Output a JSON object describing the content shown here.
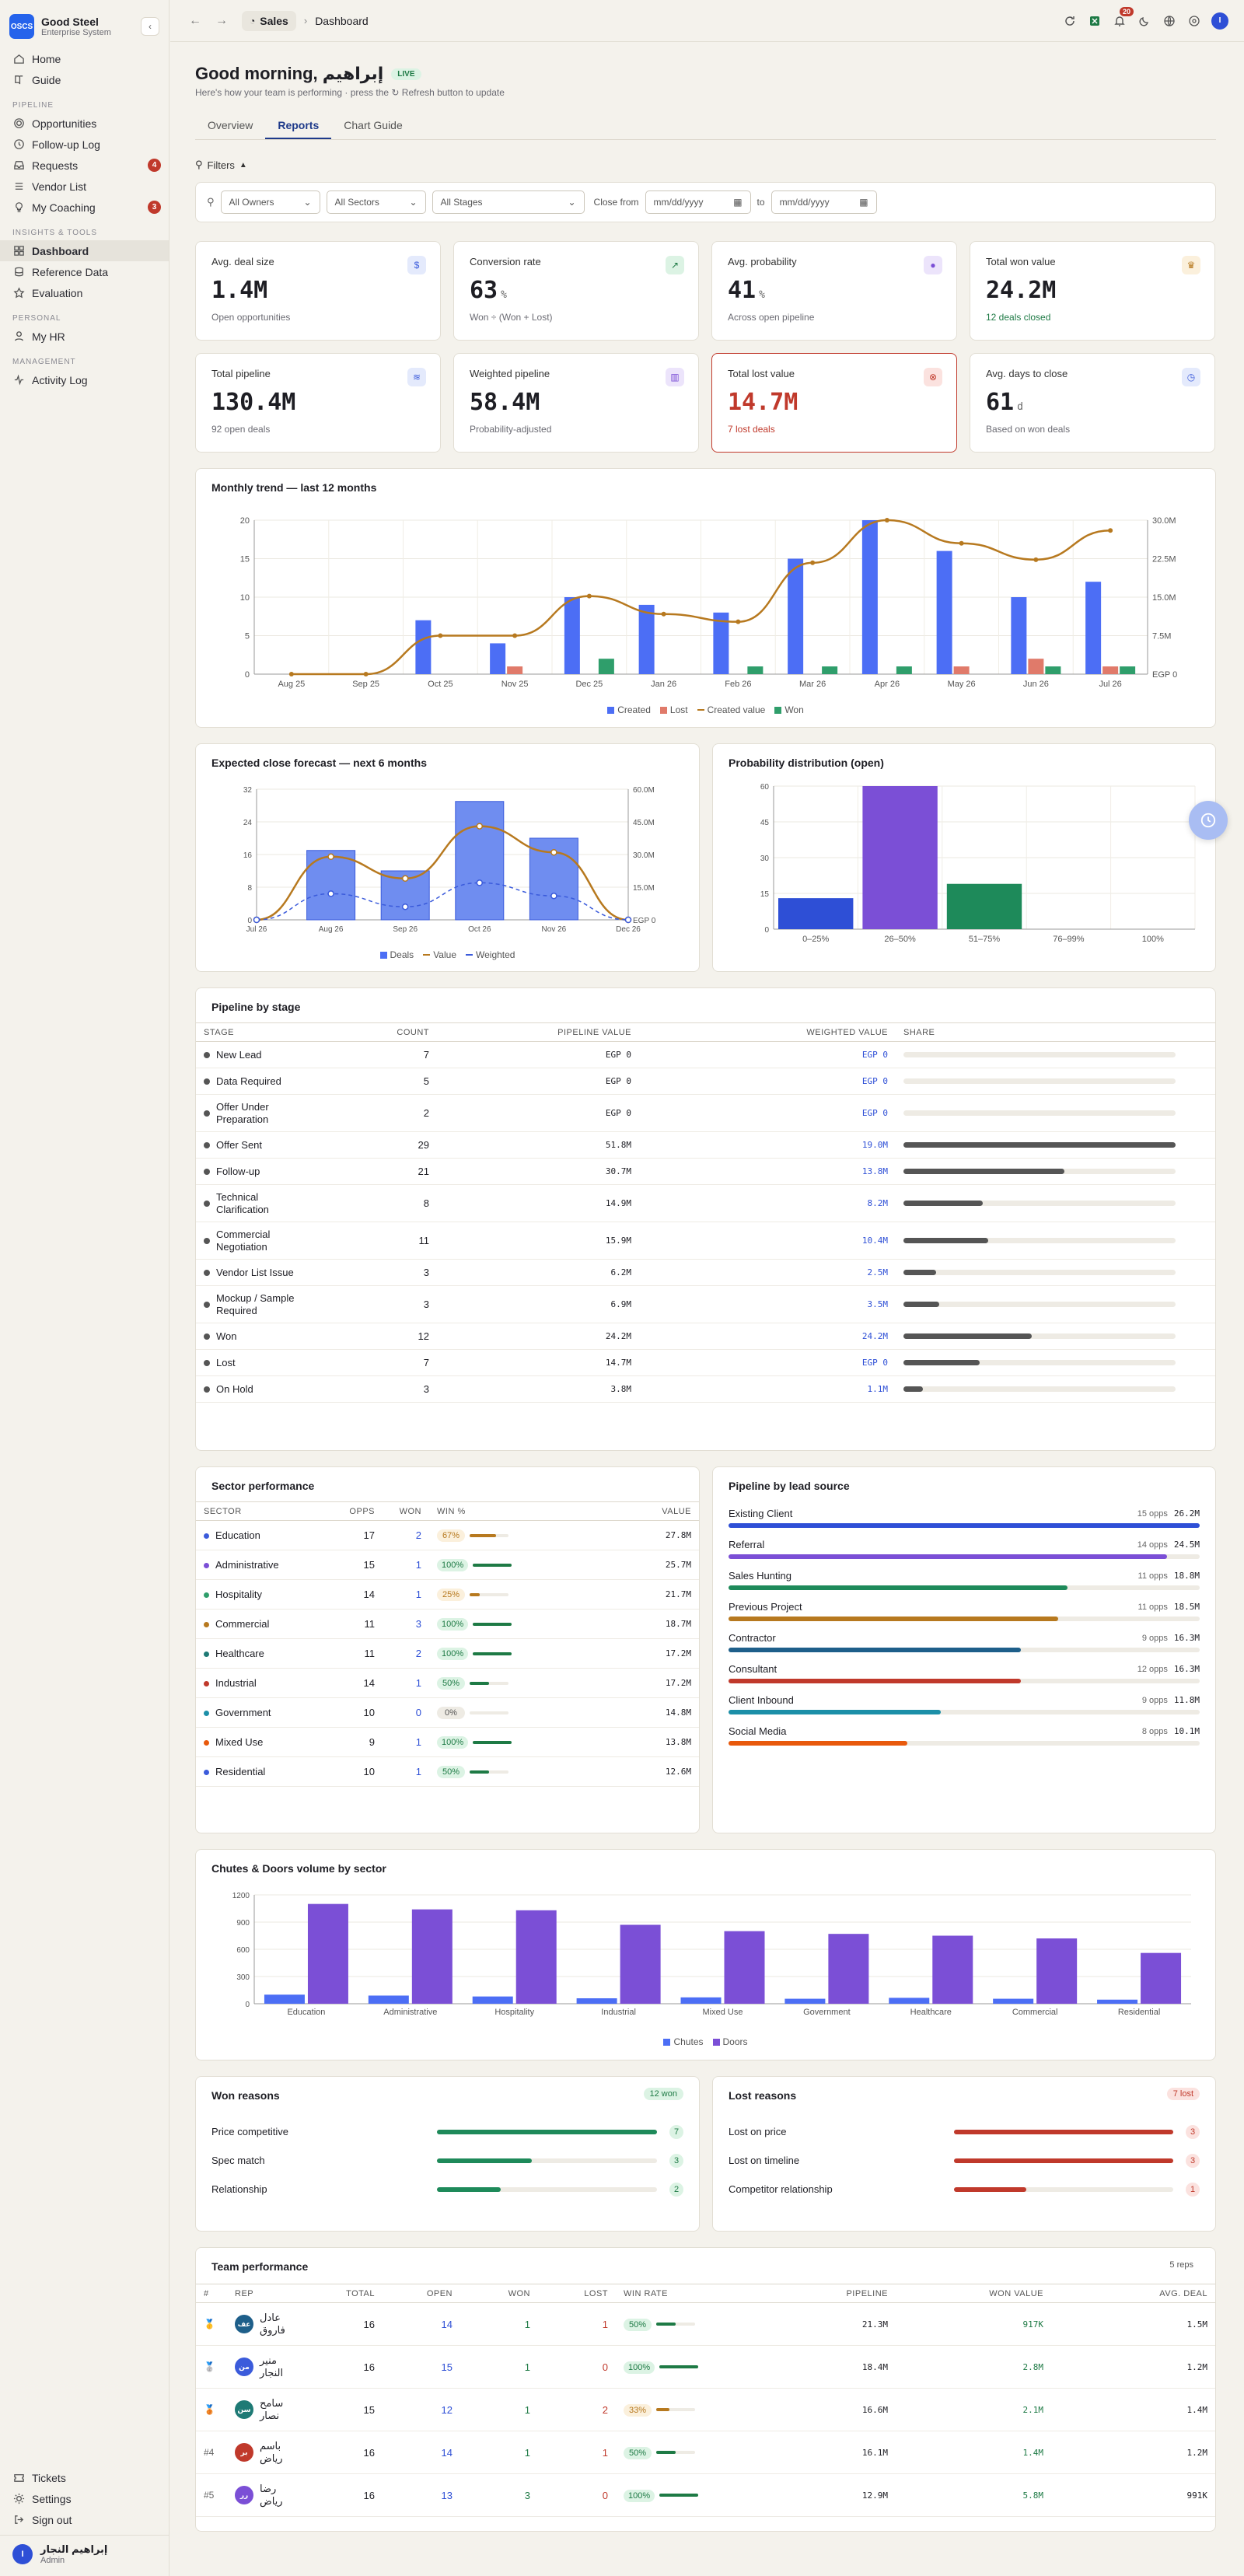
{
  "brand": {
    "logo": "OSCS",
    "name": "Good Steel",
    "sub": "Enterprise System"
  },
  "nav": {
    "top": [
      {
        "label": "Home",
        "icon": "home-icon"
      },
      {
        "label": "Guide",
        "icon": "book-icon"
      }
    ],
    "pipeline_title": "PIPELINE",
    "pipeline": [
      {
        "label": "Opportunities",
        "icon": "target-icon",
        "badge": ""
      },
      {
        "label": "Follow-up Log",
        "icon": "clock-icon",
        "badge": ""
      },
      {
        "label": "Requests",
        "icon": "inbox-icon",
        "badge": "4"
      },
      {
        "label": "Vendor List",
        "icon": "list-icon",
        "badge": ""
      },
      {
        "label": "My Coaching",
        "icon": "lightbulb-icon",
        "badge": "3"
      }
    ],
    "insights_title": "INSIGHTS & TOOLS",
    "insights": [
      {
        "label": "Dashboard",
        "icon": "grid-icon",
        "active": true
      },
      {
        "label": "Reference Data",
        "icon": "database-icon"
      },
      {
        "label": "Evaluation",
        "icon": "star-icon"
      }
    ],
    "personal_title": "PERSONAL",
    "personal": [
      {
        "label": "My HR",
        "icon": "person-icon"
      }
    ],
    "management_title": "MANAGEMENT",
    "management": [
      {
        "label": "Activity Log",
        "icon": "activity-icon"
      }
    ],
    "bottom": [
      {
        "label": "Tickets",
        "icon": "ticket-icon"
      },
      {
        "label": "Settings",
        "icon": "gear-icon"
      },
      {
        "label": "Sign out",
        "icon": "signout-icon"
      }
    ]
  },
  "user": {
    "initial": "I",
    "name": "إبراهيم النجار",
    "role": "Admin"
  },
  "topbar": {
    "crumb_root": "Sales",
    "crumb_current": "Dashboard",
    "notif_count": "20",
    "avatar": "I"
  },
  "header": {
    "greeting": "Good morning, إبراهيم",
    "live": "LIVE",
    "subtitle": "Here's how your team is performing · press the ↻ Refresh button to update"
  },
  "tabs": [
    "Overview",
    "Reports",
    "Chart Guide"
  ],
  "filters": {
    "toggle": "Filters",
    "owners": "All Owners",
    "sectors": "All Sectors",
    "stages": "All Stages",
    "close_from": "Close from",
    "date_ph": "mm/dd/yyyy",
    "to": "to"
  },
  "kpis": [
    {
      "title": "Avg. deal size",
      "value": "1.4M",
      "unit": "",
      "sub": "Open opportunities",
      "icon": "$",
      "color": "#3b5bdb",
      "bg": "#e4eafc",
      "sub_color": "#6b6b73"
    },
    {
      "title": "Conversion rate",
      "value": "63",
      "unit": "%",
      "sub": "Won ÷ (Won + Lost)",
      "icon": "↗",
      "color": "#1e7a45",
      "bg": "#dcf3e4",
      "sub_color": "#6b6b73"
    },
    {
      "title": "Avg. probability",
      "value": "41",
      "unit": "%",
      "sub": "Across open pipeline",
      "icon": "●",
      "color": "#7b4fd6",
      "bg": "#ece4fb",
      "sub_color": "#6b6b73"
    },
    {
      "title": "Total won value",
      "value": "24.2M",
      "unit": "",
      "sub": "12 deals closed",
      "icon": "♛",
      "color": "#b7791f",
      "bg": "#fbf0dc",
      "sub_color": "#1e7a45"
    },
    {
      "title": "Total pipeline",
      "value": "130.4M",
      "unit": "",
      "sub": "92 open deals",
      "icon": "≋",
      "color": "#3b5bdb",
      "bg": "#e4eafc",
      "sub_color": "#6b6b73"
    },
    {
      "title": "Weighted pipeline",
      "value": "58.4M",
      "unit": "",
      "sub": "Probability-adjusted",
      "icon": "▥",
      "color": "#7b4fd6",
      "bg": "#ece4fb",
      "sub_color": "#6b6b73"
    },
    {
      "title": "Total lost value",
      "value": "14.7M",
      "unit": "",
      "sub": "7 lost deals",
      "icon": "⊗",
      "color": "#c0392b",
      "bg": "#fbe2df",
      "sub_color": "#c0392b",
      "alert": true
    },
    {
      "title": "Avg. days to close",
      "value": "61",
      "unit": "d",
      "sub": "Based on won deals",
      "icon": "◷",
      "color": "#3b5bdb",
      "bg": "#e4eafc",
      "sub_color": "#6b6b73"
    }
  ],
  "monthly": {
    "title": "Monthly trend — last 12 months",
    "chart_data": {
      "type": "bar",
      "categories": [
        "Aug 25",
        "Sep 25",
        "Oct 25",
        "Nov 25",
        "Dec 25",
        "Jan 26",
        "Feb 26",
        "Mar 26",
        "Apr 26",
        "May 26",
        "Jun 26",
        "Jul 26"
      ],
      "series": [
        {
          "name": "Created",
          "values": [
            0,
            0,
            7,
            4,
            10,
            9,
            8,
            15,
            20,
            16,
            10,
            12
          ],
          "color": "#4c6ef5"
        },
        {
          "name": "Lost",
          "values": [
            0,
            0,
            0,
            1,
            0,
            0,
            0,
            0,
            0,
            1,
            2,
            1
          ],
          "color": "#e07a6a"
        },
        {
          "name": "Won",
          "values": [
            0,
            0,
            0,
            0,
            2,
            0,
            1,
            1,
            1,
            0,
            1,
            1
          ],
          "color": "#2f9e6b"
        },
        {
          "name": "Created value",
          "values": [
            0,
            0,
            7.5,
            7.5,
            15.2,
            11.7,
            10.2,
            21.7,
            30,
            25.5,
            22.3,
            28
          ],
          "color": "#b7791f",
          "axis": "right"
        }
      ],
      "ylim": [
        0,
        20
      ],
      "y2lim": [
        0,
        30
      ],
      "yticks": [
        0,
        5,
        10,
        15,
        20
      ],
      "y2ticks": [
        "EGP 0",
        "7.5M",
        "15.0M",
        "22.5M",
        "30.0M"
      ]
    }
  },
  "forecast": {
    "title": "Expected close forecast — next 6 months",
    "chart_data": {
      "type": "bar",
      "categories": [
        "Jul 26",
        "Aug 26",
        "Sep 26",
        "Oct 26",
        "Nov 26",
        "Dec 26"
      ],
      "series": [
        {
          "name": "Deals",
          "values": [
            0,
            17,
            12,
            29,
            20,
            0
          ],
          "color": "#4c6ef5"
        },
        {
          "name": "Value",
          "values": [
            0,
            29,
            19,
            43,
            31,
            0
          ],
          "color": "#b7791f",
          "axis": "right"
        },
        {
          "name": "Weighted",
          "values": [
            0,
            12,
            6,
            17,
            11,
            0
          ],
          "color": "#3b5bdb",
          "axis": "right"
        }
      ],
      "ylim": [
        0,
        32
      ],
      "y2lim": [
        0,
        60
      ],
      "yticks": [
        0,
        8,
        16,
        24,
        32
      ],
      "y2ticks": [
        "EGP 0",
        "15.0M",
        "30.0M",
        "45.0M",
        "60.0M"
      ]
    }
  },
  "probability": {
    "title": "Probability distribution (open)",
    "chart_data": {
      "type": "bar",
      "categories": [
        "0–25%",
        "26–50%",
        "51–75%",
        "76–99%",
        "100%"
      ],
      "values": [
        13,
        60,
        19,
        0,
        0
      ],
      "colors": [
        "#2e4fd6",
        "#7b4fd6",
        "#1e8a5a",
        "#999",
        "#999"
      ],
      "ylim": [
        0,
        60
      ],
      "yticks": [
        0,
        15,
        30,
        45,
        60
      ]
    }
  },
  "stages": {
    "title": "Pipeline by stage",
    "cols": [
      "STAGE",
      "COUNT",
      "PIPELINE VALUE",
      "WEIGHTED VALUE",
      "SHARE"
    ],
    "rows": [
      {
        "stage": "New Lead",
        "count": "7",
        "pv": "EGP 0",
        "wv": "EGP 0",
        "share": 0,
        "h": 34
      },
      {
        "stage": "Data Required",
        "count": "5",
        "pv": "EGP 0",
        "wv": "EGP 0",
        "share": 0,
        "h": 34
      },
      {
        "stage": "Offer Under Preparation",
        "count": "2",
        "pv": "EGP 0",
        "wv": "EGP 0",
        "share": 0,
        "h": 48
      },
      {
        "stage": "Offer Sent",
        "count": "29",
        "pv": "51.8M",
        "wv": "19.0M",
        "share": 1,
        "h": 34
      },
      {
        "stage": "Follow-up",
        "count": "21",
        "pv": "30.7M",
        "wv": "13.8M",
        "share": 0.59,
        "h": 34
      },
      {
        "stage": "Technical Clarification",
        "count": "8",
        "pv": "14.9M",
        "wv": "8.2M",
        "share": 0.29,
        "h": 48
      },
      {
        "stage": "Commercial Negotiation",
        "count": "11",
        "pv": "15.9M",
        "wv": "10.4M",
        "share": 0.31,
        "h": 48
      },
      {
        "stage": "Vendor List Issue",
        "count": "3",
        "pv": "6.2M",
        "wv": "2.5M",
        "share": 0.12,
        "h": 34
      },
      {
        "stage": "Mockup / Sample Required",
        "count": "3",
        "pv": "6.9M",
        "wv": "3.5M",
        "share": 0.13,
        "h": 48
      },
      {
        "stage": "Won",
        "count": "12",
        "pv": "24.2M",
        "wv": "24.2M",
        "share": 0.47,
        "h": 34
      },
      {
        "stage": "Lost",
        "count": "7",
        "pv": "14.7M",
        "wv": "EGP 0",
        "share": 0.28,
        "h": 34
      },
      {
        "stage": "On Hold",
        "count": "3",
        "pv": "3.8M",
        "wv": "1.1M",
        "share": 0.07,
        "h": 34
      }
    ]
  },
  "sectors": {
    "title": "Sector performance",
    "cols": [
      "SECTOR",
      "OPPS",
      "WON",
      "WIN %",
      "VALUE"
    ],
    "rows": [
      {
        "name": "Education",
        "opps": "17",
        "won": "2",
        "win": "67%",
        "wp": 0.67,
        "value": "27.8M",
        "c": "#3b5bdb",
        "pc": "amber"
      },
      {
        "name": "Administrative",
        "opps": "15",
        "won": "1",
        "win": "100%",
        "wp": 1,
        "value": "25.7M",
        "c": "#7b4fd6",
        "pc": "green"
      },
      {
        "name": "Hospitality",
        "opps": "14",
        "won": "1",
        "win": "25%",
        "wp": 0.25,
        "value": "21.7M",
        "c": "#2f9e6b",
        "pc": "amber"
      },
      {
        "name": "Commercial",
        "opps": "11",
        "won": "3",
        "win": "100%",
        "wp": 1,
        "value": "18.7M",
        "c": "#b7791f",
        "pc": "green"
      },
      {
        "name": "Healthcare",
        "opps": "11",
        "won": "2",
        "win": "100%",
        "wp": 1,
        "value": "17.2M",
        "c": "#1e7a75",
        "pc": "green"
      },
      {
        "name": "Industrial",
        "opps": "14",
        "won": "1",
        "win": "50%",
        "wp": 0.5,
        "value": "17.2M",
        "c": "#c0392b",
        "pc": "green"
      },
      {
        "name": "Government",
        "opps": "10",
        "won": "0",
        "win": "0%",
        "wp": 0,
        "value": "14.8M",
        "c": "#1c8fa8",
        "pc": "grey"
      },
      {
        "name": "Mixed Use",
        "opps": "9",
        "won": "1",
        "win": "100%",
        "wp": 1,
        "value": "13.8M",
        "c": "#e8590c",
        "pc": "green"
      },
      {
        "name": "Residential",
        "opps": "10",
        "won": "1",
        "win": "50%",
        "wp": 0.5,
        "value": "12.6M",
        "c": "#3b5bdb",
        "pc": "green"
      }
    ]
  },
  "sources": {
    "title": "Pipeline by lead source",
    "rows": [
      {
        "name": "Existing Client",
        "opps": "15 opps",
        "value": "26.2M",
        "p": 1,
        "c": "#2e4fd6"
      },
      {
        "name": "Referral",
        "opps": "14 opps",
        "value": "24.5M",
        "p": 0.93,
        "c": "#7b4fd6"
      },
      {
        "name": "Sales Hunting",
        "opps": "11 opps",
        "value": "18.8M",
        "p": 0.72,
        "c": "#1e8a5a"
      },
      {
        "name": "Previous Project",
        "opps": "11 opps",
        "value": "18.5M",
        "p": 0.7,
        "c": "#b7791f"
      },
      {
        "name": "Contractor",
        "opps": "9 opps",
        "value": "16.3M",
        "p": 0.62,
        "c": "#1e5f8a"
      },
      {
        "name": "Consultant",
        "opps": "12 opps",
        "value": "16.3M",
        "p": 0.62,
        "c": "#c0392b"
      },
      {
        "name": "Client Inbound",
        "opps": "9 opps",
        "value": "11.8M",
        "p": 0.45,
        "c": "#1c8fa8"
      },
      {
        "name": "Social Media",
        "opps": "8 opps",
        "value": "10.1M",
        "p": 0.38,
        "c": "#e8590c"
      }
    ]
  },
  "volume": {
    "title": "Chutes & Doors volume by sector",
    "chart_data": {
      "type": "bar",
      "categories": [
        "Education",
        "Administrative",
        "Hospitality",
        "Industrial",
        "Mixed Use",
        "Government",
        "Healthcare",
        "Commercial",
        "Residential"
      ],
      "series": [
        {
          "name": "Chutes",
          "values": [
            100,
            90,
            80,
            60,
            70,
            55,
            65,
            55,
            45
          ],
          "color": "#4c6ef5"
        },
        {
          "name": "Doors",
          "values": [
            1100,
            1040,
            1030,
            870,
            800,
            770,
            750,
            720,
            560
          ],
          "color": "#7b4fd6"
        }
      ],
      "ylim": [
        0,
        1200
      ],
      "yticks": [
        0,
        300,
        600,
        900,
        1200
      ]
    }
  },
  "won_reasons": {
    "title": "Won reasons",
    "badge": "12 won",
    "rows": [
      {
        "name": "Price competitive",
        "count": "7",
        "p": 1
      },
      {
        "name": "Spec match",
        "count": "3",
        "p": 0.43
      },
      {
        "name": "Relationship",
        "count": "2",
        "p": 0.29
      }
    ]
  },
  "lost_reasons": {
    "title": "Lost reasons",
    "badge": "7 lost",
    "rows": [
      {
        "name": "Lost on price",
        "count": "3",
        "p": 1
      },
      {
        "name": "Lost on timeline",
        "count": "3",
        "p": 1
      },
      {
        "name": "Competitor relationship",
        "count": "1",
        "p": 0.33
      }
    ]
  },
  "team": {
    "title": "Team performance",
    "badge": "5 reps",
    "cols": [
      "#",
      "REP",
      "TOTAL",
      "OPEN",
      "WON",
      "LOST",
      "WIN RATE",
      "PIPELINE",
      "WON VALUE",
      "AVG. DEAL"
    ],
    "rows": [
      {
        "rank": "🥇",
        "init": "عف",
        "name": "عادل فاروق",
        "c": "#1e5f8a",
        "total": "16",
        "open": "14",
        "won": "1",
        "lost": "1",
        "win": "50%",
        "wp": 0.5,
        "pipe": "21.3M",
        "wonv": "917K",
        "avg": "1.5M",
        "pc": "green"
      },
      {
        "rank": "🥈",
        "init": "من",
        "name": "منير النجار",
        "c": "#3b5bdb",
        "total": "16",
        "open": "15",
        "won": "1",
        "lost": "0",
        "win": "100%",
        "wp": 1,
        "pipe": "18.4M",
        "wonv": "2.8M",
        "avg": "1.2M",
        "pc": "green"
      },
      {
        "rank": "🥉",
        "init": "سن",
        "name": "سامح نصار",
        "c": "#1e7a75",
        "total": "15",
        "open": "12",
        "won": "1",
        "lost": "2",
        "win": "33%",
        "wp": 0.33,
        "pipe": "16.6M",
        "wonv": "2.1M",
        "avg": "1.4M",
        "pc": "amber"
      },
      {
        "rank": "#4",
        "init": "بر",
        "name": "باسم رياض",
        "c": "#c0392b",
        "total": "16",
        "open": "14",
        "won": "1",
        "lost": "1",
        "win": "50%",
        "wp": 0.5,
        "pipe": "16.1M",
        "wonv": "1.4M",
        "avg": "1.2M",
        "pc": "green"
      },
      {
        "rank": "#5",
        "init": "رر",
        "name": "رضا رياض",
        "c": "#7b4fd6",
        "total": "16",
        "open": "13",
        "won": "3",
        "lost": "0",
        "win": "100%",
        "wp": 1,
        "pipe": "12.9M",
        "wonv": "5.8M",
        "avg": "991K",
        "pc": "green"
      }
    ]
  }
}
